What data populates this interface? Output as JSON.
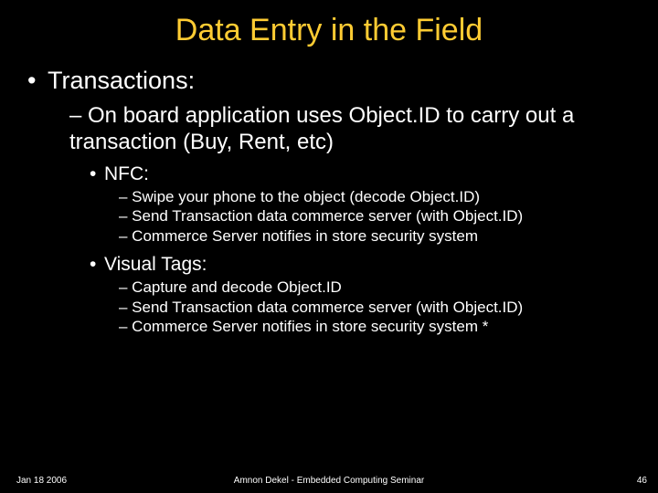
{
  "title": "Data Entry in the Field",
  "l1": {
    "bullet": "•",
    "text": "Transactions:"
  },
  "l2": {
    "text": "– On board application uses Object.ID to carry out a transaction (Buy, Rent, etc)"
  },
  "nfc": {
    "bullet": "•",
    "label": "NFC:",
    "items": [
      "– Swipe your phone to the object (decode Object.ID)",
      "– Send Transaction data commerce server (with Object.ID)",
      "– Commerce Server notifies in store security system"
    ]
  },
  "visual": {
    "bullet": "•",
    "label": "Visual Tags:",
    "items": [
      "– Capture and decode Object.ID",
      "– Send Transaction data commerce server (with Object.ID)",
      "– Commerce Server notifies in store security system *"
    ]
  },
  "footer": {
    "left": "Jan 18 2006",
    "center": "Amnon Dekel - Embedded Computing Seminar",
    "right": "46"
  }
}
